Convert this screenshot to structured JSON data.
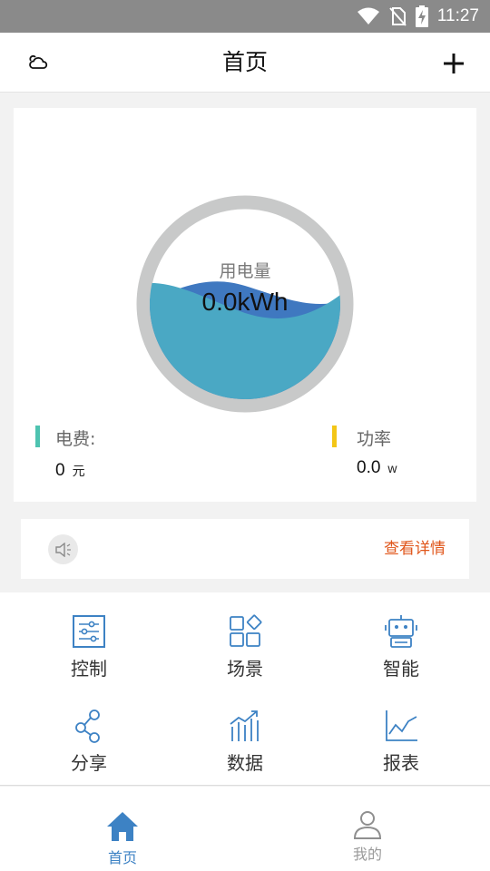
{
  "status_bar": {
    "time": "11:27",
    "icons": [
      "wifi-icon",
      "no-sim-icon",
      "battery-charging-icon"
    ]
  },
  "header": {
    "title": "首页",
    "left_icon": "weather-cloud-icon",
    "right_icon": "plus-icon"
  },
  "gauge": {
    "label": "用电量",
    "value": "0.0kWh",
    "ring_color": "#c8c9c9",
    "water_color": "#4aa8c4",
    "back_wave_color": "#3f78c0"
  },
  "stats": {
    "fee": {
      "label": "电费:",
      "value": "0",
      "unit": "元",
      "color": "#4ec3b0"
    },
    "power": {
      "label": "功率",
      "value": "0.0",
      "unit": "w",
      "color": "#f3c617"
    }
  },
  "notice": {
    "icon": "speaker-icon",
    "link": "查看详情",
    "link_color": "#e0561b"
  },
  "features": [
    {
      "label": "控制",
      "icon": "sliders-icon"
    },
    {
      "label": "场景",
      "icon": "scene-blocks-icon"
    },
    {
      "label": "智能",
      "icon": "robot-icon"
    },
    {
      "label": "分享",
      "icon": "share-icon"
    },
    {
      "label": "数据",
      "icon": "bar-chart-trend-icon"
    },
    {
      "label": "报表",
      "icon": "line-chart-icon"
    }
  ],
  "tabbar": {
    "items": [
      {
        "label": "首页",
        "icon": "home-icon",
        "active": true
      },
      {
        "label": "我的",
        "icon": "user-icon",
        "active": false
      }
    ],
    "active_color": "#3d82c4"
  }
}
